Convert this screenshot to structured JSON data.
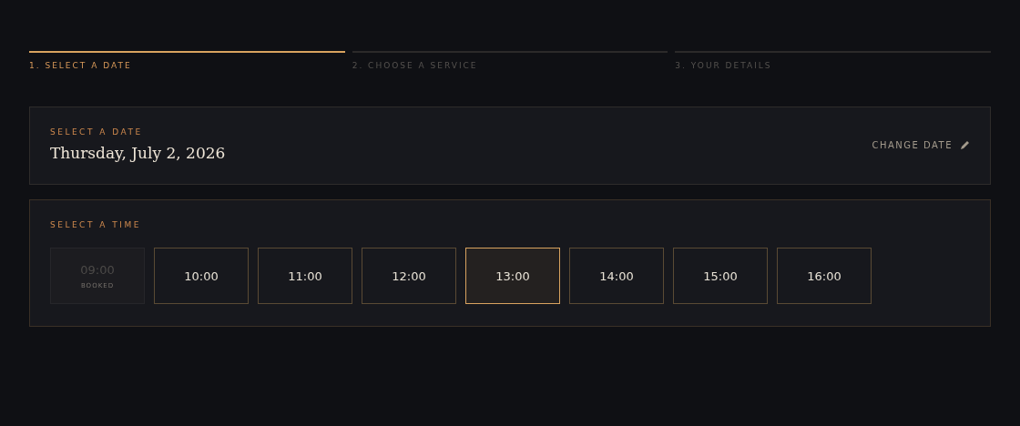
{
  "steps": [
    {
      "label": "1. SELECT A DATE",
      "selected": true
    },
    {
      "label": "2. CHOOSE A SERVICE",
      "selected": false
    },
    {
      "label": "3. YOUR DETAILS",
      "selected": false
    }
  ],
  "date_card": {
    "label": "SELECT A DATE",
    "value": "Thursday, July 2, 2026",
    "action": "CHANGE DATE"
  },
  "time_card": {
    "label": "SELECT A TIME",
    "slots": [
      {
        "time": "09:00",
        "disabled": true,
        "selected": false,
        "note": "BOOKED"
      },
      {
        "time": "10:00",
        "disabled": false,
        "selected": false
      },
      {
        "time": "11:00",
        "disabled": false,
        "selected": false
      },
      {
        "time": "12:00",
        "disabled": false,
        "selected": false
      },
      {
        "time": "13:00",
        "disabled": false,
        "selected": true
      },
      {
        "time": "14:00",
        "disabled": false,
        "selected": false
      },
      {
        "time": "15:00",
        "disabled": false,
        "selected": false
      },
      {
        "time": "16:00",
        "disabled": false,
        "selected": false
      }
    ]
  }
}
